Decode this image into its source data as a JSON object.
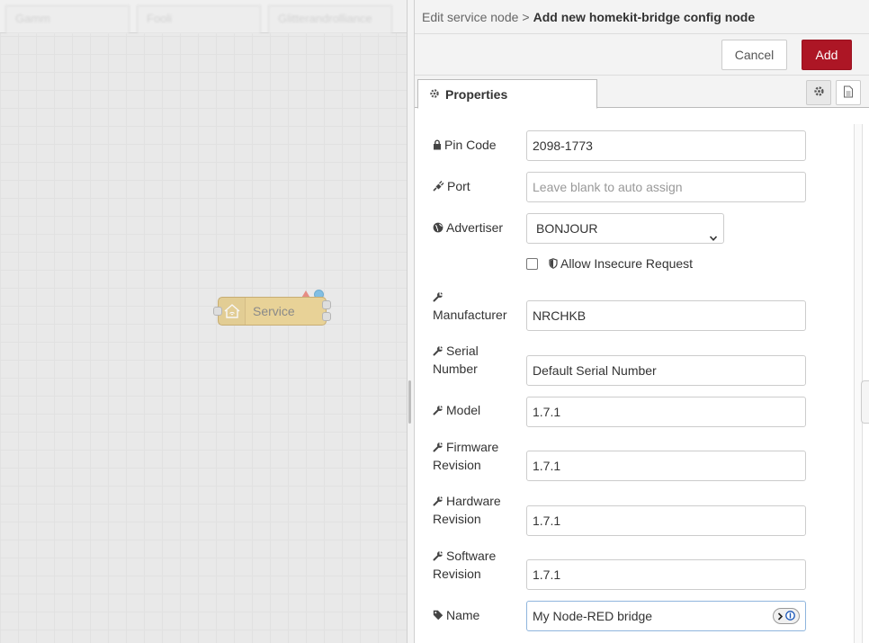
{
  "workspace": {
    "tabs": [
      "Gamm",
      "Fooli",
      "Glitterandrolliance"
    ],
    "node": {
      "label": "Service",
      "icon": "homekit-icon"
    }
  },
  "tray": {
    "breadcrumb": {
      "parent": "Edit service node",
      "separator": ">",
      "current": "Add new homekit-bridge config node"
    },
    "buttons": {
      "cancel": "Cancel",
      "add": "Add"
    },
    "tab": {
      "label": "Properties",
      "icon": "gear-icon"
    },
    "colors": {
      "add_button": "#ad1625",
      "node": "#e7c56b",
      "status_dot": "#4aa8df"
    },
    "form": {
      "pin_code": {
        "label": "Pin Code",
        "icon": "lock-icon",
        "value": "2098-1773"
      },
      "port": {
        "label": "Port",
        "icon": "plug-icon",
        "placeholder": "Leave blank to auto assign"
      },
      "advertiser": {
        "label": "Advertiser",
        "icon": "globe-icon",
        "value": "BONJOUR"
      },
      "allow_insecure": {
        "label": "Allow Insecure Request",
        "icon": "shield-icon",
        "checked": false
      },
      "manufacturer": {
        "label": "Manufacturer",
        "icon": "wrench-icon",
        "value": "NRCHKB"
      },
      "serial_number": {
        "label_line1": "Serial",
        "label_line2": "Number",
        "icon": "wrench-icon",
        "value": "Default Serial Number"
      },
      "model": {
        "label": "Model",
        "icon": "wrench-icon",
        "value": "1.7.1"
      },
      "firmware_revision": {
        "label_line1": "Firmware",
        "label_line2": "Revision",
        "icon": "wrench-icon",
        "value": "1.7.1"
      },
      "hardware_revision": {
        "label_line1": "Hardware",
        "label_line2": "Revision",
        "icon": "wrench-icon",
        "value": "1.7.1"
      },
      "software_revision": {
        "label_line1": "Software",
        "label_line2": "Revision",
        "icon": "wrench-icon",
        "value": "1.7.1"
      },
      "name": {
        "label": "Name",
        "icon": "tag-icon",
        "value": "My Node-RED bridge"
      }
    }
  }
}
